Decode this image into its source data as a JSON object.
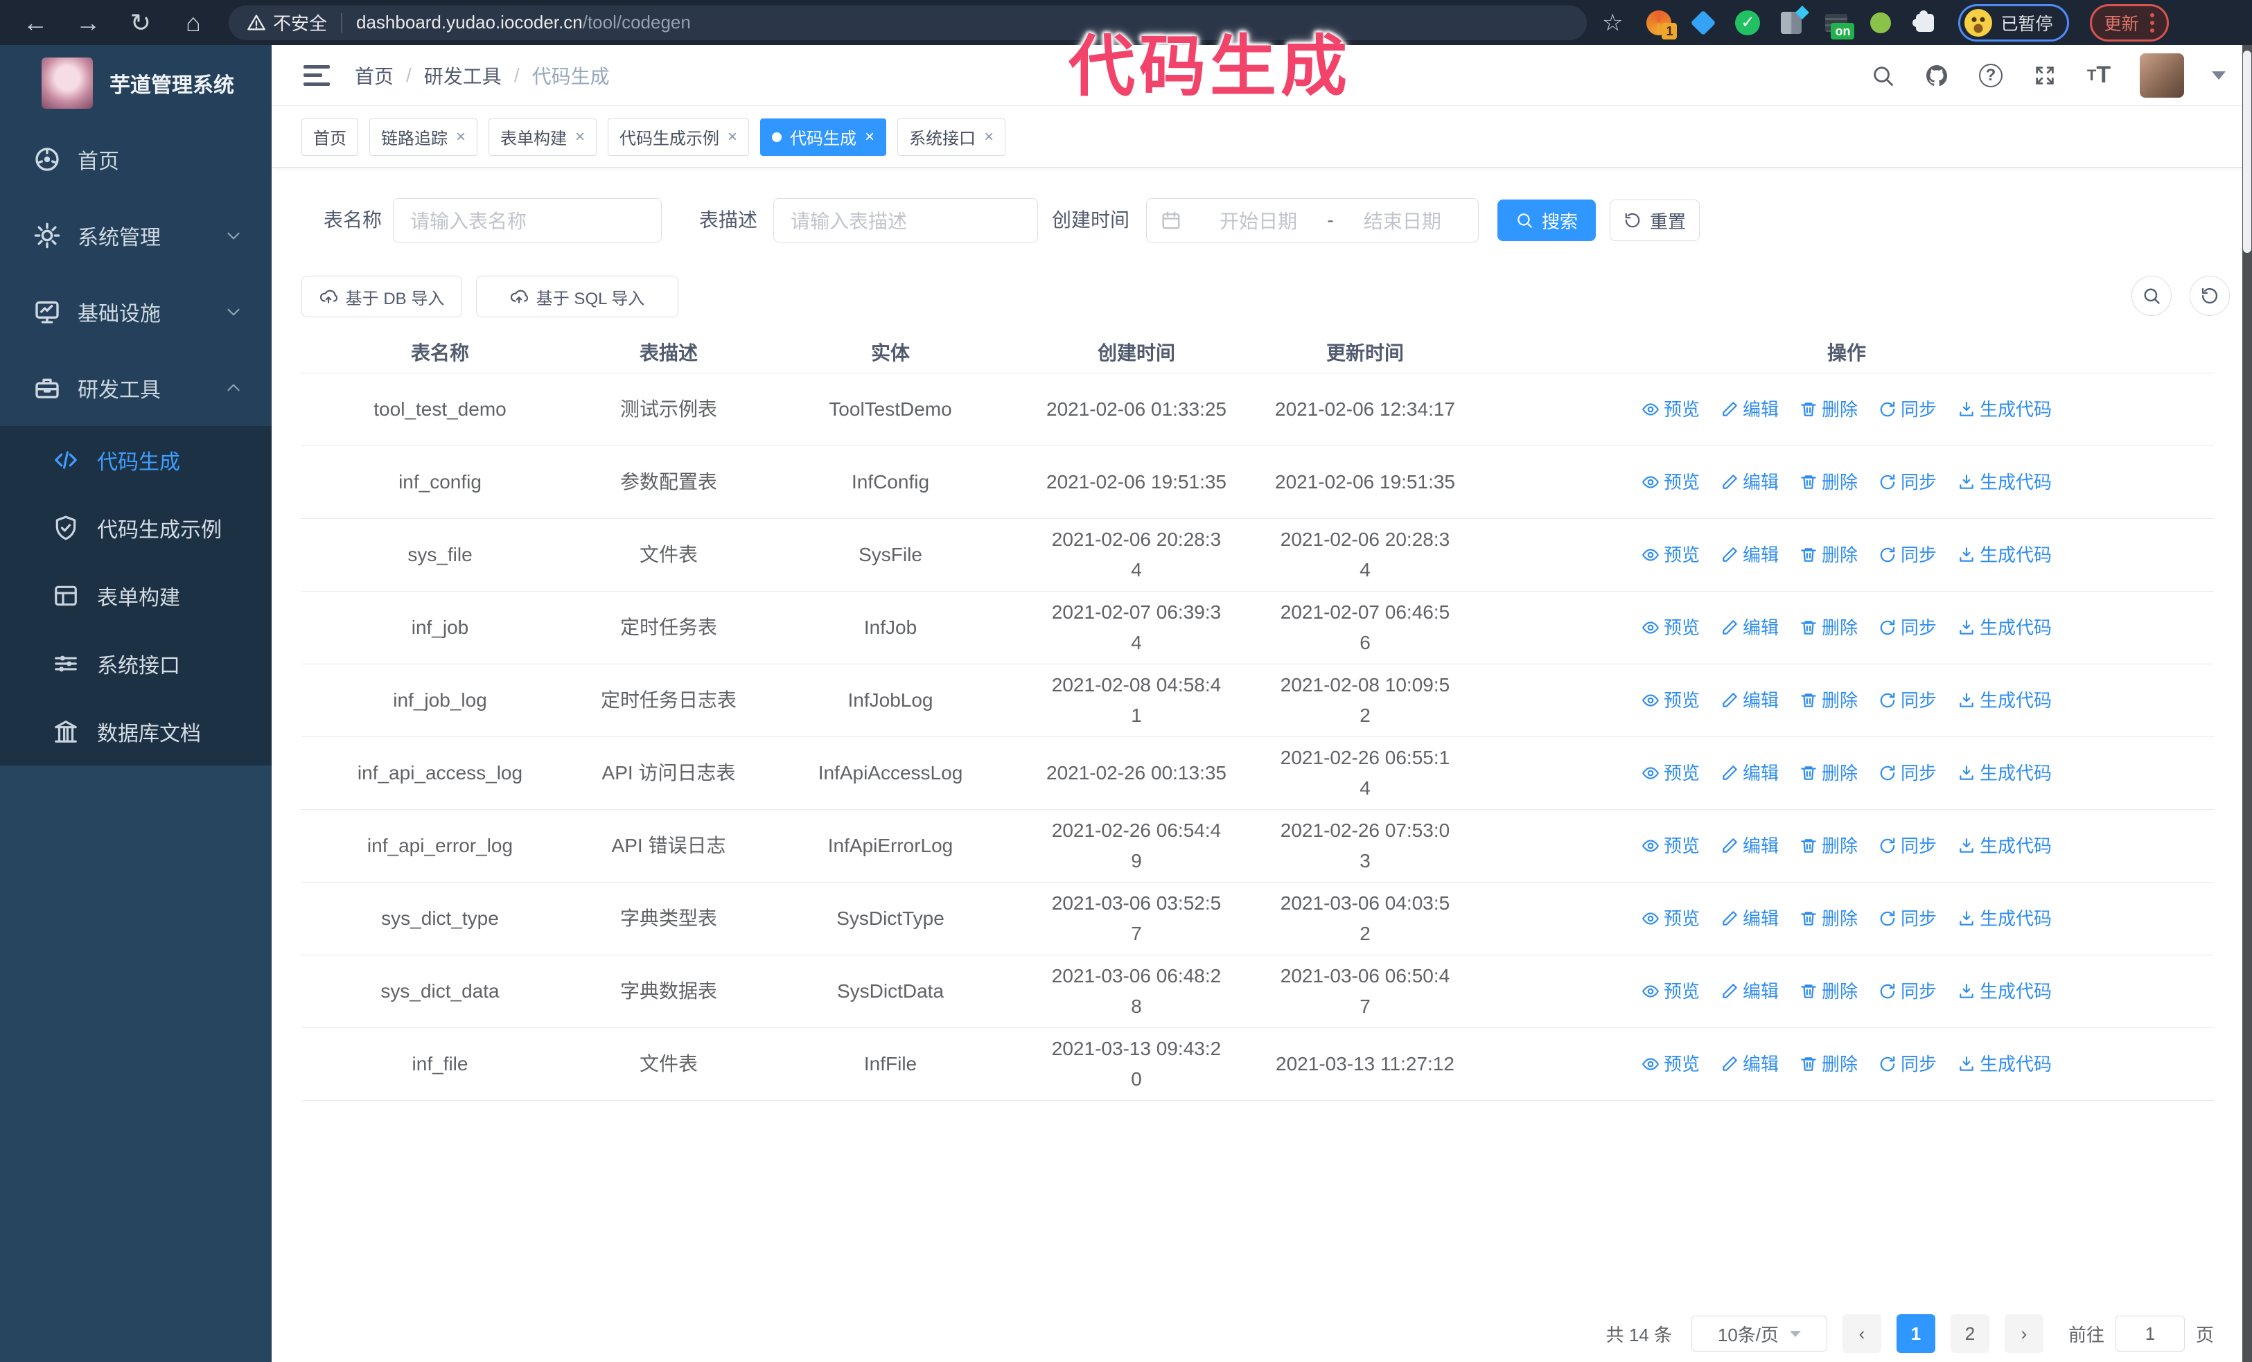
{
  "browser": {
    "security_warning": "不安全",
    "url_host": "dashboard.yudao.iocoder.cn",
    "url_path": "/tool/codegen",
    "extension_count_badge": "1",
    "extension_on_badge": "on",
    "paused_badge": "已暂停",
    "update_button": "更新"
  },
  "annotation": {
    "text": "代码生成",
    "color": "#f2436a"
  },
  "sidebar": {
    "title": "芋道管理系统",
    "items": [
      {
        "label": "首页",
        "icon": "home-icon",
        "chevron": ""
      },
      {
        "label": "系统管理",
        "icon": "gear-icon",
        "chevron": "down"
      },
      {
        "label": "基础设施",
        "icon": "monitor-icon",
        "chevron": "down"
      },
      {
        "label": "研发工具",
        "icon": "toolbox-icon",
        "chevron": "up"
      }
    ],
    "submenu": [
      {
        "label": "代码生成",
        "icon": "code-icon",
        "active": true
      },
      {
        "label": "代码生成示例",
        "icon": "shield-check-icon",
        "active": false
      },
      {
        "label": "表单构建",
        "icon": "form-icon",
        "active": false
      },
      {
        "label": "系统接口",
        "icon": "sliders-icon",
        "active": false
      },
      {
        "label": "数据库文档",
        "icon": "database-doc-icon",
        "active": false
      }
    ]
  },
  "header": {
    "breadcrumb": [
      "首页",
      "研发工具",
      "代码生成"
    ]
  },
  "tabs": [
    {
      "label": "首页",
      "closable": false,
      "active": false
    },
    {
      "label": "链路追踪",
      "closable": true,
      "active": false
    },
    {
      "label": "表单构建",
      "closable": true,
      "active": false
    },
    {
      "label": "代码生成示例",
      "closable": true,
      "active": false
    },
    {
      "label": "代码生成",
      "closable": true,
      "active": true
    },
    {
      "label": "系统接口",
      "closable": true,
      "active": false
    }
  ],
  "filters": {
    "table_name_label": "表名称",
    "table_name_placeholder": "请输入表名称",
    "table_desc_label": "表描述",
    "table_desc_placeholder": "请输入表描述",
    "create_time_label": "创建时间",
    "date_start_placeholder": "开始日期",
    "date_separator": "-",
    "date_end_placeholder": "结束日期",
    "search_button": "搜索",
    "reset_button": "重置"
  },
  "toolbar": {
    "import_db": "基于 DB 导入",
    "import_sql": "基于 SQL 导入"
  },
  "table": {
    "columns": [
      "表名称",
      "表描述",
      "实体",
      "创建时间",
      "更新时间",
      "操作"
    ],
    "actions": [
      {
        "label": "预览",
        "icon": "eye-icon"
      },
      {
        "label": "编辑",
        "icon": "edit-icon"
      },
      {
        "label": "删除",
        "icon": "delete-icon"
      },
      {
        "label": "同步",
        "icon": "sync-icon"
      },
      {
        "label": "生成代码",
        "icon": "download-icon"
      }
    ],
    "rows": [
      {
        "name": "tool_test_demo",
        "desc": "测试示例表",
        "entity": "ToolTestDemo",
        "created": "2021-02-06 01:33:25",
        "updated": "2021-02-06 12:34:17"
      },
      {
        "name": "inf_config",
        "desc": "参数配置表",
        "entity": "InfConfig",
        "created": "2021-02-06 19:51:35",
        "updated": "2021-02-06 19:51:35"
      },
      {
        "name": "sys_file",
        "desc": "文件表",
        "entity": "SysFile",
        "created": "2021-02-06 20:28:3\n4",
        "updated": "2021-02-06 20:28:3\n4"
      },
      {
        "name": "inf_job",
        "desc": "定时任务表",
        "entity": "InfJob",
        "created": "2021-02-07 06:39:3\n4",
        "updated": "2021-02-07 06:46:5\n6"
      },
      {
        "name": "inf_job_log",
        "desc": "定时任务日志表",
        "entity": "InfJobLog",
        "created": "2021-02-08 04:58:4\n1",
        "updated": "2021-02-08 10:09:5\n2"
      },
      {
        "name": "inf_api_access_log",
        "desc": "API 访问日志表",
        "entity": "InfApiAccessLog",
        "created": "2021-02-26 00:13:35",
        "updated": "2021-02-26 06:55:1\n4"
      },
      {
        "name": "inf_api_error_log",
        "desc": "API 错误日志",
        "entity": "InfApiErrorLog",
        "created": "2021-02-26 06:54:4\n9",
        "updated": "2021-02-26 07:53:0\n3"
      },
      {
        "name": "sys_dict_type",
        "desc": "字典类型表",
        "entity": "SysDictType",
        "created": "2021-03-06 03:52:5\n7",
        "updated": "2021-03-06 04:03:5\n2"
      },
      {
        "name": "sys_dict_data",
        "desc": "字典数据表",
        "entity": "SysDictData",
        "created": "2021-03-06 06:48:2\n8",
        "updated": "2021-03-06 06:50:4\n7"
      },
      {
        "name": "inf_file",
        "desc": "文件表",
        "entity": "InfFile",
        "created": "2021-03-13 09:43:2\n0",
        "updated": "2021-03-13 11:27:12"
      }
    ]
  },
  "pagination": {
    "total": "共 14 条",
    "page_size": "10条/页",
    "pages": [
      "1",
      "2"
    ],
    "active_page": "1",
    "goto_label": "前往",
    "goto_value": "1",
    "goto_suffix": "页"
  },
  "colors": {
    "accent": "#2f97ff",
    "link": "#2d8cf0",
    "sidebar_bg": "#24405a",
    "submenu_bg": "#1d3144",
    "chrome_bg": "#1d2634"
  }
}
